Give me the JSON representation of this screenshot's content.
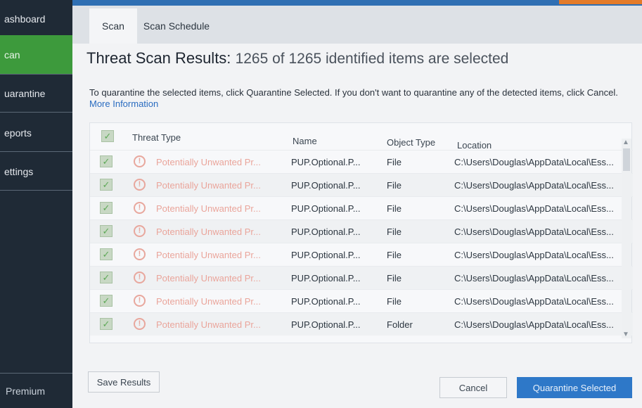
{
  "sidebar": {
    "items": [
      {
        "label": "ashboard",
        "active": false
      },
      {
        "label": "can",
        "active": true
      },
      {
        "label": "uarantine",
        "active": false
      },
      {
        "label": "eports",
        "active": false
      },
      {
        "label": "ettings",
        "active": false
      }
    ],
    "premium_label": "Premium"
  },
  "tabs": [
    {
      "label": "Scan",
      "active": true
    },
    {
      "label": "Scan Schedule",
      "active": false
    }
  ],
  "header": {
    "title": "Threat Scan Results:",
    "subtitle": "1265 of 1265 identified items are selected"
  },
  "instructions": {
    "text": "To quarantine the selected items, click Quarantine Selected. If you don't want to quarantine any of the detected items, click Cancel.",
    "link": "More Information"
  },
  "table": {
    "columns": {
      "threat_type": "Threat Type",
      "name": "Name",
      "object_type": "Object Type",
      "location": "Location"
    },
    "rows": [
      {
        "threat": "Potentially Unwanted Pr...",
        "name": "PUP.Optional.P...",
        "type": "File",
        "location": "C:\\Users\\Douglas\\AppData\\Local\\Ess..."
      },
      {
        "threat": "Potentially Unwanted Pr...",
        "name": "PUP.Optional.P...",
        "type": "File",
        "location": "C:\\Users\\Douglas\\AppData\\Local\\Ess..."
      },
      {
        "threat": "Potentially Unwanted Pr...",
        "name": "PUP.Optional.P...",
        "type": "File",
        "location": "C:\\Users\\Douglas\\AppData\\Local\\Ess..."
      },
      {
        "threat": "Potentially Unwanted Pr...",
        "name": "PUP.Optional.P...",
        "type": "File",
        "location": "C:\\Users\\Douglas\\AppData\\Local\\Ess..."
      },
      {
        "threat": "Potentially Unwanted Pr...",
        "name": "PUP.Optional.P...",
        "type": "File",
        "location": "C:\\Users\\Douglas\\AppData\\Local\\Ess..."
      },
      {
        "threat": "Potentially Unwanted Pr...",
        "name": "PUP.Optional.P...",
        "type": "File",
        "location": "C:\\Users\\Douglas\\AppData\\Local\\Ess..."
      },
      {
        "threat": "Potentially Unwanted Pr...",
        "name": "PUP.Optional.P...",
        "type": "File",
        "location": "C:\\Users\\Douglas\\AppData\\Local\\Ess..."
      },
      {
        "threat": "Potentially Unwanted Pr...",
        "name": "PUP.Optional.P...",
        "type": "Folder",
        "location": "C:\\Users\\Douglas\\AppData\\Local\\Ess..."
      }
    ]
  },
  "buttons": {
    "save": "Save Results",
    "cancel": "Cancel",
    "quarantine": "Quarantine Selected"
  },
  "colors": {
    "sidebar_bg": "#1f2a36",
    "active_green": "#3d9a3c",
    "primary_blue": "#2e78c8",
    "threat_text": "#eaa59b"
  }
}
